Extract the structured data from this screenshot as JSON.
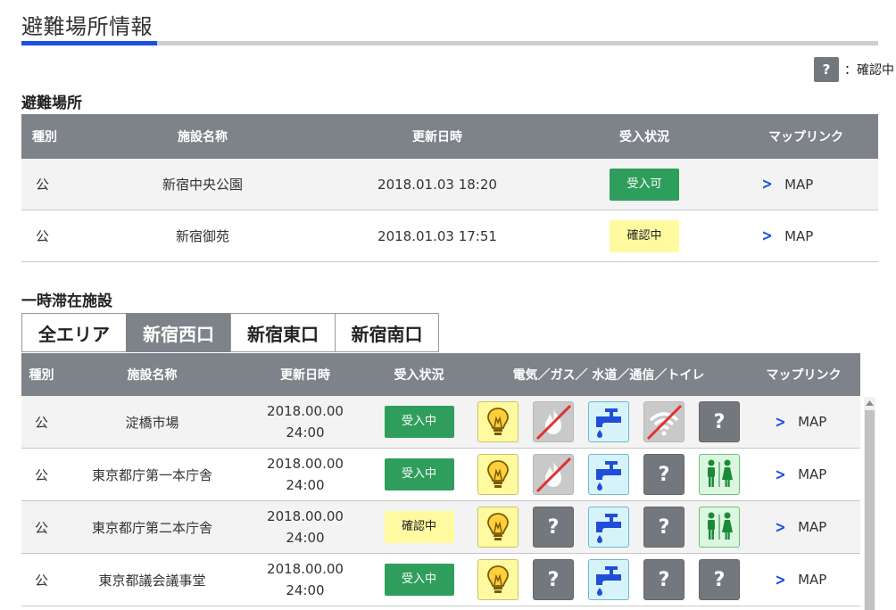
{
  "page": {
    "title": "避難場所情報"
  },
  "legend": {
    "symbol": "?",
    "label": "：確認中"
  },
  "shelters": {
    "title": "避難場所",
    "headers": [
      "種別",
      "施設名称",
      "更新日時",
      "受入状況",
      "マップリンク"
    ],
    "rows": [
      {
        "type": "公",
        "name": "新宿中央公園",
        "updated": "2018.01.03 18:20",
        "status": "受入可",
        "status_kind": "ok",
        "map": "MAP"
      },
      {
        "type": "公",
        "name": "新宿御苑",
        "updated": "2018.01.03 17:51",
        "status": "確認中",
        "status_kind": "check",
        "map": "MAP"
      }
    ]
  },
  "facilities": {
    "title": "一時滞在施設",
    "tabs": [
      "全エリア",
      "新宿西口",
      "新宿東口",
      "新宿南口"
    ],
    "active_tab": "新宿西口",
    "headers": [
      "種別",
      "施設名称",
      "更新日時",
      "受入状況",
      "電気／ガス／ 水道／通信／トイレ",
      "マップリンク"
    ],
    "unknown_symbol": "?",
    "rows": [
      {
        "type": "公",
        "name": "淀橋市場",
        "date": "2018.00.00",
        "time": "24:00",
        "status": "受入中",
        "status_kind": "ok",
        "utilities": [
          "electricity",
          "gas-unavailable",
          "water",
          "wifi-unavailable",
          "unknown"
        ],
        "map": "MAP"
      },
      {
        "type": "公",
        "name": "東京都庁第一本庁舎",
        "date": "2018.00.00",
        "time": "24:00",
        "status": "受入中",
        "status_kind": "ok",
        "utilities": [
          "electricity",
          "gas-unavailable",
          "water",
          "unknown",
          "toilet"
        ],
        "map": "MAP"
      },
      {
        "type": "公",
        "name": "東京都庁第二本庁舎",
        "date": "2018.00.00",
        "time": "24:00",
        "status": "確認中",
        "status_kind": "check",
        "utilities": [
          "electricity",
          "unknown",
          "water",
          "unknown",
          "toilet"
        ],
        "map": "MAP"
      },
      {
        "type": "公",
        "name": "東京都議会議事堂",
        "date": "2018.00.00",
        "time": "24:00",
        "status": "受入中",
        "status_kind": "ok",
        "utilities": [
          "electricity",
          "unknown",
          "water",
          "unknown",
          "unknown"
        ],
        "map": "MAP"
      }
    ]
  },
  "colors": {
    "accent": "#1a4fe0",
    "header_bg": "#7d8389",
    "status_ok": "#2f9e5c",
    "status_check": "#fffaa0"
  }
}
